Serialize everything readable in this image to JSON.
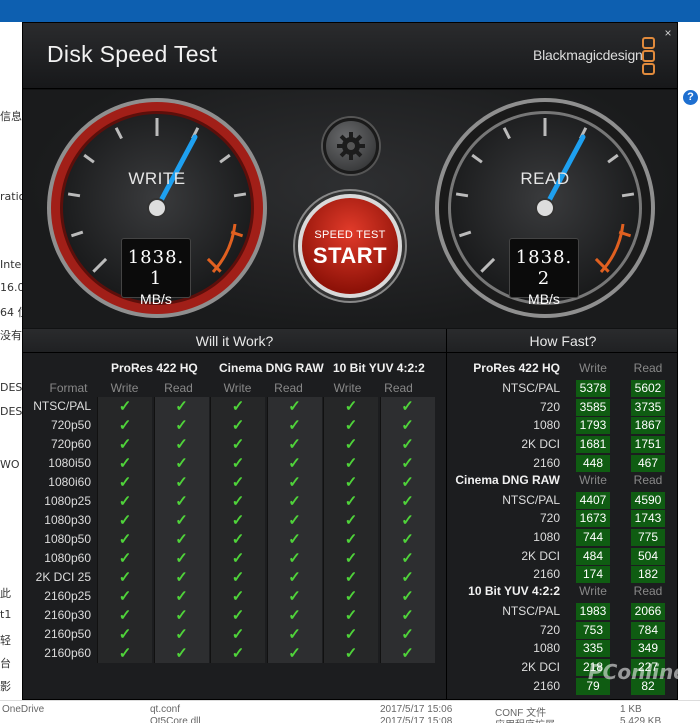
{
  "background": {
    "left_fragments": [
      "信息",
      "ratio",
      "Inte",
      "16.0",
      "64 位",
      "没有",
      "DESI",
      "DESI",
      "WO",
      "此",
      "t1",
      "轻",
      "台",
      "影"
    ],
    "bottom_drive": "OneDrive",
    "bottom_files": [
      {
        "name": "qt.conf",
        "date": "2017/5/17 15:06",
        "type": "CONF 文件",
        "size": "1 KB"
      },
      {
        "name": "Qt5Core.dll",
        "date": "2017/5/17 15:08",
        "type": "应用程序扩展",
        "size": "5,429 KB"
      }
    ]
  },
  "app": {
    "title": "Disk Speed Test",
    "brand": "Blackmagicdesign",
    "close": "×"
  },
  "gauges": {
    "write": {
      "label": "WRITE",
      "value": "1838. 1",
      "unit": "MB/s"
    },
    "read": {
      "label": "READ",
      "value": "1838. 2",
      "unit": "MB/s"
    }
  },
  "start_button": {
    "line1": "SPEED TEST",
    "line2": "START"
  },
  "will_it_work": {
    "title": "Will it Work?",
    "format_label": "Format",
    "groups": [
      {
        "name": "ProRes 422 HQ",
        "write": "Write",
        "read": "Read"
      },
      {
        "name": "Cinema DNG RAW",
        "write": "Write",
        "read": "Read"
      },
      {
        "name": "10 Bit YUV 4:2:2",
        "write": "Write",
        "read": "Read"
      }
    ],
    "formats": [
      "NTSC/PAL",
      "720p50",
      "720p60",
      "1080i50",
      "1080i60",
      "1080p25",
      "1080p30",
      "1080p50",
      "1080p60",
      "2K DCI 25",
      "2160p25",
      "2160p30",
      "2160p50",
      "2160p60"
    ],
    "check_glyph": "✓"
  },
  "how_fast": {
    "title": "How Fast?",
    "write_label": "Write",
    "read_label": "Read",
    "groups": [
      {
        "name": "ProRes 422 HQ",
        "rows": [
          {
            "fmt": "NTSC/PAL",
            "write": "5378",
            "read": "5602"
          },
          {
            "fmt": "720",
            "write": "3585",
            "read": "3735"
          },
          {
            "fmt": "1080",
            "write": "1793",
            "read": "1867"
          },
          {
            "fmt": "2K DCI",
            "write": "1681",
            "read": "1751"
          },
          {
            "fmt": "2160",
            "write": "448",
            "read": "467"
          }
        ]
      },
      {
        "name": "Cinema DNG RAW",
        "rows": [
          {
            "fmt": "NTSC/PAL",
            "write": "4407",
            "read": "4590"
          },
          {
            "fmt": "720",
            "write": "1673",
            "read": "1743"
          },
          {
            "fmt": "1080",
            "write": "744",
            "read": "775"
          },
          {
            "fmt": "2K DCI",
            "write": "484",
            "read": "504"
          },
          {
            "fmt": "2160",
            "write": "174",
            "read": "182"
          }
        ]
      },
      {
        "name": "10 Bit YUV 4:2:2",
        "rows": [
          {
            "fmt": "NTSC/PAL",
            "write": "1983",
            "read": "2066"
          },
          {
            "fmt": "720",
            "write": "753",
            "read": "784"
          },
          {
            "fmt": "1080",
            "write": "335",
            "read": "349"
          },
          {
            "fmt": "2K DCI",
            "write": "218",
            "read": "227"
          },
          {
            "fmt": "2160",
            "write": "79",
            "read": "82"
          }
        ]
      }
    ]
  },
  "watermark": "PConline",
  "colors": {
    "accent_blue": "#1ea0f0",
    "write_ring": "#b3231c",
    "check_green": "#4fd33a",
    "value_green_bg": "#0f5c12",
    "start_red": "#d1301f"
  }
}
